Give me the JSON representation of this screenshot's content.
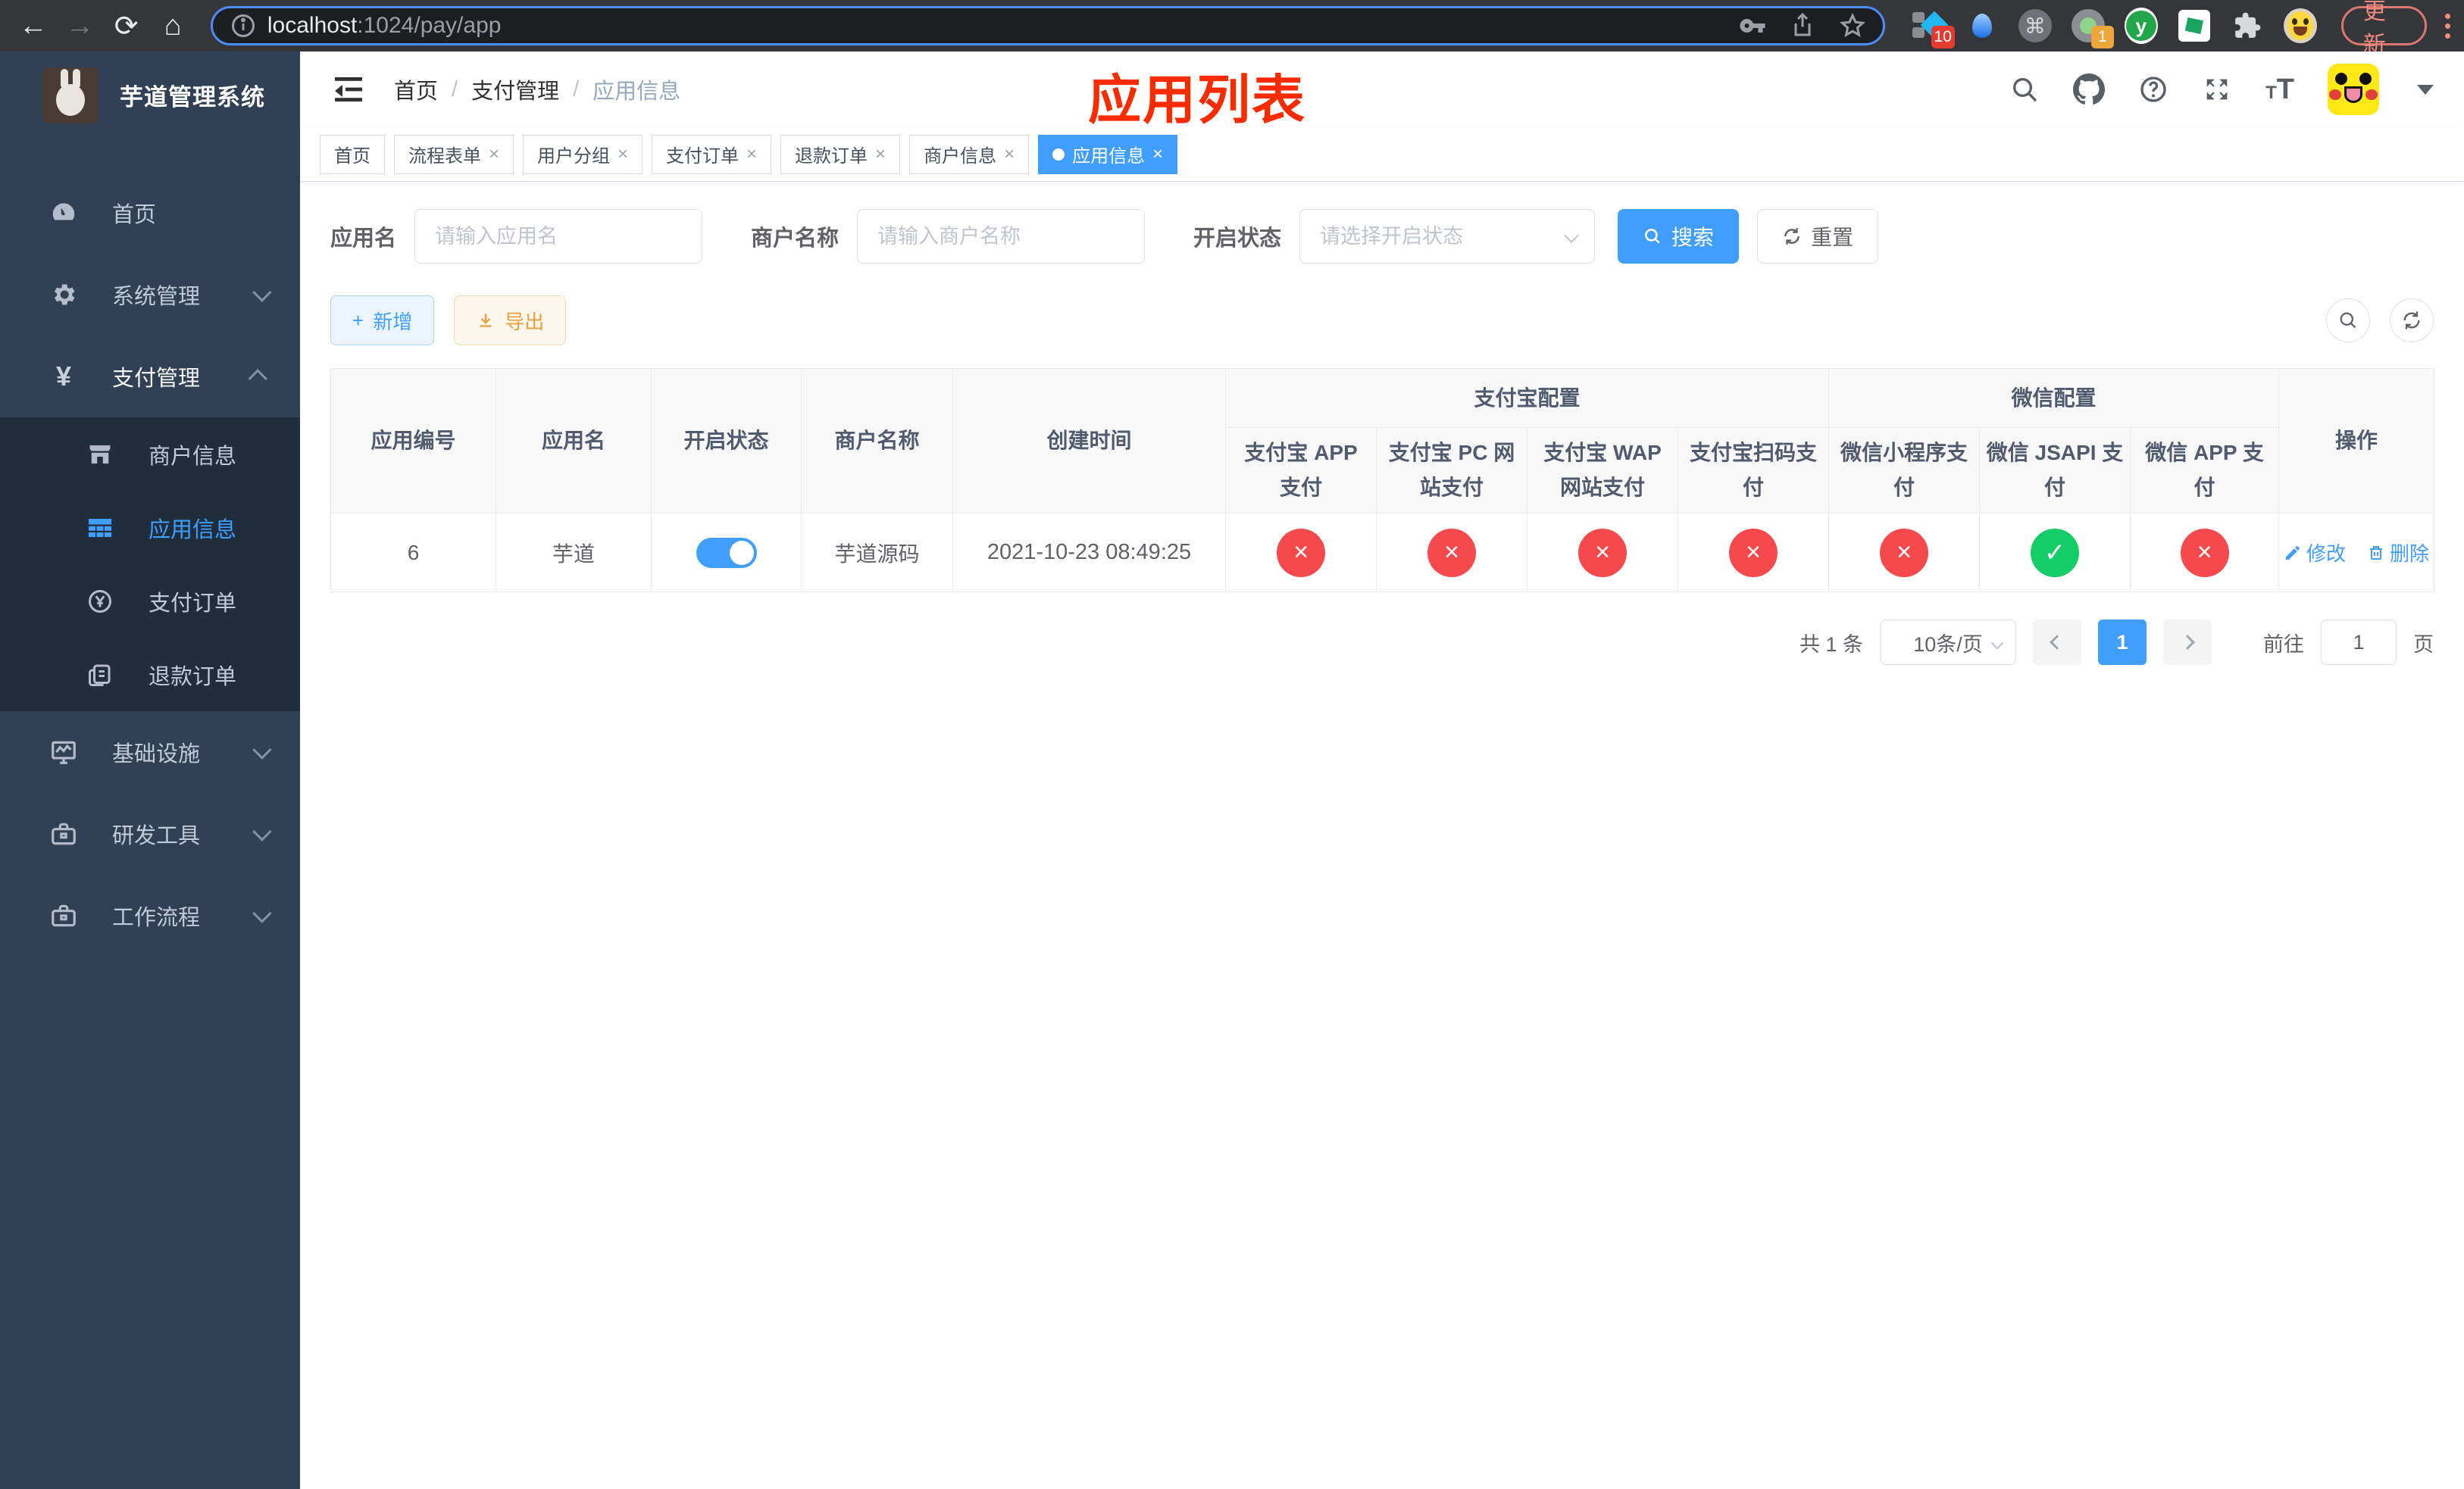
{
  "browser": {
    "url_host": "localhost",
    "url_rest": ":1024/pay/app",
    "update_label": "更新",
    "ext_badge_flow": "10",
    "ext_badge_rec": "1",
    "ext_y_letter": "y",
    "cmd_glyph": "⌘"
  },
  "annotation": "应用列表",
  "sidebar": {
    "title": "芋道管理系统",
    "items": [
      {
        "label": "首页"
      },
      {
        "label": "系统管理"
      },
      {
        "label": "支付管理"
      }
    ],
    "subitems": [
      {
        "label": "商户信息"
      },
      {
        "label": "应用信息",
        "active": true
      },
      {
        "label": "支付订单"
      },
      {
        "label": "退款订单"
      }
    ],
    "items_bottom": [
      {
        "label": "基础设施"
      },
      {
        "label": "研发工具"
      },
      {
        "label": "工作流程"
      }
    ],
    "yen_glyph": "¥"
  },
  "breadcrumb": {
    "items": [
      "首页",
      "支付管理",
      "应用信息"
    ],
    "separator": "/"
  },
  "tabs": [
    {
      "label": "首页",
      "closable": false
    },
    {
      "label": "流程表单",
      "closable": true
    },
    {
      "label": "用户分组",
      "closable": true
    },
    {
      "label": "支付订单",
      "closable": true
    },
    {
      "label": "退款订单",
      "closable": true
    },
    {
      "label": "商户信息",
      "closable": true
    },
    {
      "label": "应用信息",
      "closable": true,
      "active": true
    }
  ],
  "tab_close_glyph": "×",
  "filters": {
    "app_name_label": "应用名",
    "app_name_placeholder": "请输入应用名",
    "merchant_label": "商户名称",
    "merchant_placeholder": "请输入商户名称",
    "status_label": "开启状态",
    "status_placeholder": "请选择开启状态",
    "search_label": "搜索",
    "reset_label": "重置"
  },
  "toolbar": {
    "add_label": "新增",
    "export_label": "导出",
    "add_plus": "+"
  },
  "table": {
    "simple_columns": [
      "应用编号",
      "应用名",
      "开启状态",
      "商户名称",
      "创建时间"
    ],
    "group1": {
      "label": "支付宝配置",
      "children": [
        "支付宝 APP 支付",
        "支付宝 PC 网站支付",
        "支付宝 WAP 网站支付",
        "支付宝扫码支付"
      ]
    },
    "group2": {
      "label": "微信配置",
      "children": [
        "微信小程序支付",
        "微信 JSAPI 支付",
        "微信 APP 支付"
      ]
    },
    "op_label": "操作",
    "status_icons": {
      "yes": "✓",
      "no": "×"
    },
    "row": {
      "id": "6",
      "name": "芋道",
      "enabled": true,
      "merchant": "芋道源码",
      "created": "2021-10-23 08:49:25",
      "statuses": [
        "no",
        "no",
        "no",
        "no",
        "no",
        "yes",
        "no"
      ],
      "edit_label": "修改",
      "delete_label": "删除"
    }
  },
  "pagination": {
    "total": "共 1 条",
    "page_size": "10条/页",
    "page": "1",
    "goto_prefix": "前往",
    "goto_value": "1",
    "goto_suffix": "页"
  },
  "colors": {
    "accent": "#409EFF",
    "success": "#13ce66",
    "danger": "#f5494d",
    "warning": "#E6A23C",
    "annotation_red": "#fb2b00",
    "sidebar_bg": "#304156",
    "submenu_bg": "#1f2d3d"
  }
}
